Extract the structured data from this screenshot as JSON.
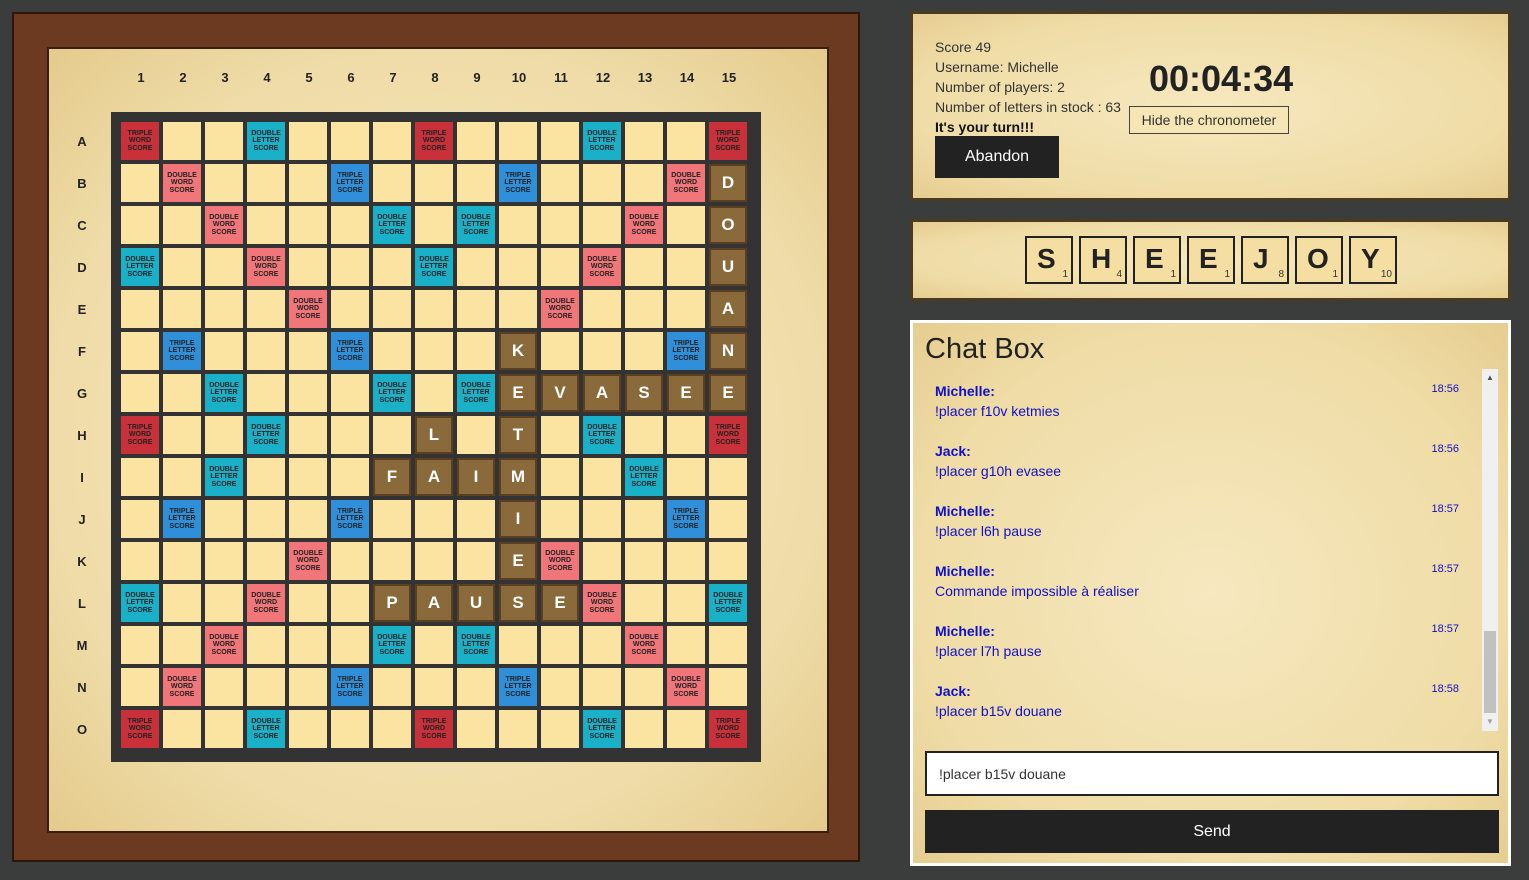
{
  "board": {
    "columns": [
      "1",
      "2",
      "3",
      "4",
      "5",
      "6",
      "7",
      "8",
      "9",
      "10",
      "11",
      "12",
      "13",
      "14",
      "15"
    ],
    "rows": [
      "A",
      "B",
      "C",
      "D",
      "E",
      "F",
      "G",
      "H",
      "I",
      "J",
      "K",
      "L",
      "M",
      "N",
      "O"
    ],
    "bonus_labels": {
      "tw": "TRIPLE WORD SCORE",
      "dw": "DOUBLE WORD SCORE",
      "tl": "TRIPLE LETTER SCORE",
      "dl": "DOUBLE LETTER SCORE"
    },
    "bonus_grid": [
      "T..d...T...d..T",
      ".D...t...t...D.",
      "..D...d.d...D..",
      "d..D...d...D..d",
      "....D.....D....",
      ".t...t...t...t.",
      "..d...d.d...d..",
      "T..d.......d..T",
      "..d...d.d...d..",
      ".t...t...t...t.",
      "....D.....D....",
      "d..D...d...D..d",
      "..D...d.d...D..",
      ".D...t...t...D.",
      "T..d...T...d..T"
    ],
    "placed_tiles": [
      {
        "row": 1,
        "col": 14,
        "letter": "D"
      },
      {
        "row": 2,
        "col": 14,
        "letter": "O"
      },
      {
        "row": 3,
        "col": 14,
        "letter": "U"
      },
      {
        "row": 4,
        "col": 14,
        "letter": "A"
      },
      {
        "row": 5,
        "col": 14,
        "letter": "N"
      },
      {
        "row": 6,
        "col": 14,
        "letter": "E"
      },
      {
        "row": 5,
        "col": 9,
        "letter": "K"
      },
      {
        "row": 6,
        "col": 9,
        "letter": "E"
      },
      {
        "row": 6,
        "col": 10,
        "letter": "V"
      },
      {
        "row": 6,
        "col": 11,
        "letter": "A"
      },
      {
        "row": 6,
        "col": 12,
        "letter": "S"
      },
      {
        "row": 6,
        "col": 13,
        "letter": "E"
      },
      {
        "row": 7,
        "col": 7,
        "letter": "L"
      },
      {
        "row": 7,
        "col": 9,
        "letter": "T"
      },
      {
        "row": 8,
        "col": 6,
        "letter": "F"
      },
      {
        "row": 8,
        "col": 7,
        "letter": "A"
      },
      {
        "row": 8,
        "col": 8,
        "letter": "I"
      },
      {
        "row": 8,
        "col": 9,
        "letter": "M"
      },
      {
        "row": 9,
        "col": 9,
        "letter": "I"
      },
      {
        "row": 10,
        "col": 9,
        "letter": "E"
      },
      {
        "row": 11,
        "col": 6,
        "letter": "P"
      },
      {
        "row": 11,
        "col": 7,
        "letter": "A"
      },
      {
        "row": 11,
        "col": 8,
        "letter": "U"
      },
      {
        "row": 11,
        "col": 9,
        "letter": "S"
      },
      {
        "row": 11,
        "col": 10,
        "letter": "E"
      }
    ]
  },
  "info": {
    "score": "Score 49",
    "username": "Username: Michelle",
    "players": "Number of players: 2",
    "stock": "Number of letters in stock : 63",
    "turn": "It's your turn!!!",
    "abandon_label": "Abandon",
    "timer": "00:04:34",
    "hide_label": "Hide the chronometer"
  },
  "rack": [
    {
      "letter": "S",
      "points": "1"
    },
    {
      "letter": "H",
      "points": "4"
    },
    {
      "letter": "E",
      "points": "1"
    },
    {
      "letter": "E",
      "points": "1"
    },
    {
      "letter": "J",
      "points": "8"
    },
    {
      "letter": "O",
      "points": "1"
    },
    {
      "letter": "Y",
      "points": "10"
    }
  ],
  "chat": {
    "title": "Chat Box",
    "messages": [
      {
        "user": "Michelle:",
        "text": "!placer f10v ketmies",
        "time": "18:56"
      },
      {
        "user": "Jack:",
        "text": "!placer g10h evasee",
        "time": "18:56"
      },
      {
        "user": "Michelle:",
        "text": "!placer l6h pause",
        "time": "18:57"
      },
      {
        "user": "Michelle:",
        "text": "Commande impossible à réaliser",
        "time": "18:57"
      },
      {
        "user": "Michelle:",
        "text": "!placer l7h pause",
        "time": "18:57"
      },
      {
        "user": "Jack:",
        "text": "!placer b15v douane",
        "time": "18:58"
      }
    ],
    "input_value": "!placer b15v douane",
    "send_label": "Send"
  }
}
